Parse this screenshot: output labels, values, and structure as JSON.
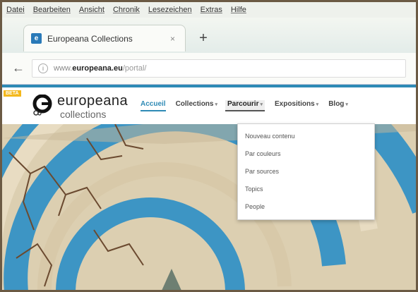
{
  "menubar": {
    "items": [
      "Datei",
      "Bearbeiten",
      "Ansicht",
      "Chronik",
      "Lesezeichen",
      "Extras",
      "Hilfe"
    ]
  },
  "browser": {
    "tab_title": "Europeana Collections",
    "tab_close": "×",
    "new_tab": "+",
    "back": "←",
    "url": {
      "prefix": "www.",
      "domain": "europeana.eu",
      "path": "/portal/"
    }
  },
  "site": {
    "beta_label": "BETA",
    "logo_word": "europeana",
    "logo_sub": "collections",
    "nav": [
      {
        "label": "Accueil"
      },
      {
        "label": "Collections"
      },
      {
        "label": "Parcourir"
      },
      {
        "label": "Expositions"
      },
      {
        "label": "Blog"
      }
    ],
    "dropdown": [
      "Nouveau contenu",
      "Par couleurs",
      "Par sources",
      "Topics",
      "People"
    ]
  },
  "colors": {
    "accent": "#2e8ab5",
    "beta": "#f4b81c"
  },
  "icons": {
    "tab_favicon": "europeana-favicon",
    "url_info": "info-icon",
    "nav_caret": "caret-down-icon"
  }
}
